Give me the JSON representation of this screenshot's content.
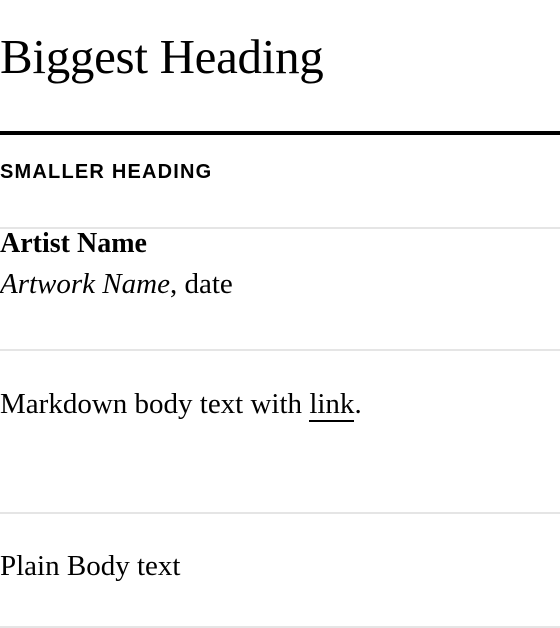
{
  "headings": {
    "biggest": "Biggest Heading",
    "smaller": "SMALLER HEADING"
  },
  "artwork_caption": {
    "artist_name": "Artist Name",
    "artwork_name": "Artwork Name",
    "separator": ", ",
    "date": "date"
  },
  "markdown_body": {
    "text_before_link": "Markdown body text with ",
    "link_label": "link",
    "text_after_link": "."
  },
  "plain_body": {
    "text": "Plain Body text"
  },
  "colors": {
    "text": "#000000",
    "background": "#ffffff",
    "thick_rule": "#000000",
    "thin_rule": "#e5e5e5"
  }
}
